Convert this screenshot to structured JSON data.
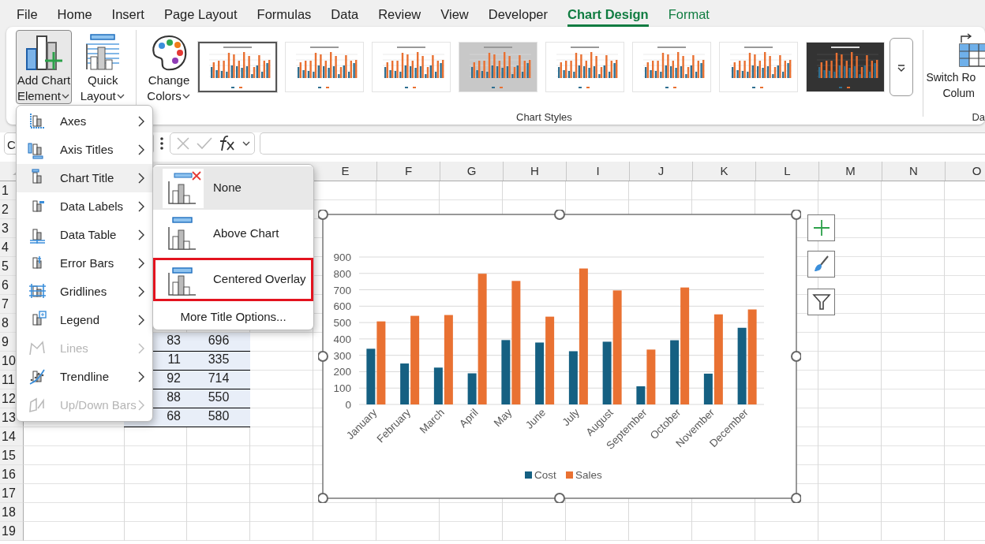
{
  "ribbon_tabs": [
    {
      "label": "File",
      "kind": "standard",
      "selected": false
    },
    {
      "label": "Home",
      "kind": "standard",
      "selected": false
    },
    {
      "label": "Insert",
      "kind": "standard",
      "selected": false
    },
    {
      "label": "Page Layout",
      "kind": "standard",
      "selected": false
    },
    {
      "label": "Formulas",
      "kind": "standard",
      "selected": false
    },
    {
      "label": "Data",
      "kind": "standard",
      "selected": false
    },
    {
      "label": "Review",
      "kind": "standard",
      "selected": false
    },
    {
      "label": "View",
      "kind": "standard",
      "selected": false
    },
    {
      "label": "Developer",
      "kind": "standard",
      "selected": false
    },
    {
      "label": "Chart Design",
      "kind": "contextual",
      "selected": true
    },
    {
      "label": "Format",
      "kind": "contextual",
      "selected": false
    }
  ],
  "ribbon": {
    "buttons": [
      {
        "kind": "add-element",
        "lines": [
          "Add Chart",
          "Element"
        ],
        "selected": true
      },
      {
        "kind": "quick-layout",
        "lines": [
          "Quick",
          "Layout"
        ],
        "selected": false
      },
      {
        "kind": "change-colors",
        "lines": [
          "Change",
          "Colors"
        ],
        "selected": false
      }
    ],
    "chart_styles": {
      "label": "Chart Styles",
      "items": [
        {
          "selected": true,
          "color": "#ffffff"
        },
        {
          "selected": false,
          "color": "#ffffff"
        },
        {
          "selected": false,
          "color": "#ffffff"
        },
        {
          "selected": false,
          "color": "#c8c8c8"
        },
        {
          "selected": false,
          "color": "#ffffff"
        },
        {
          "selected": false,
          "color": "#ffffff"
        },
        {
          "selected": false,
          "color": "#ffffff"
        },
        {
          "selected": false,
          "color": "#333333"
        }
      ]
    },
    "switch_button": {
      "lines": [
        "Switch Ro",
        "Colum"
      ]
    },
    "next_group_label": "Da"
  },
  "formula_bar": {
    "name_box": "C"
  },
  "sheet": {
    "column_headers": [
      "E",
      "F",
      "G",
      "H",
      "I",
      "J",
      "K",
      "L",
      "M",
      "N",
      "O"
    ],
    "rows": [
      {
        "number": "1"
      },
      {
        "number": "2"
      },
      {
        "number": "3"
      },
      {
        "number": "4"
      },
      {
        "number": "5"
      },
      {
        "number": "6"
      },
      {
        "number": "7"
      },
      {
        "number": "8"
      },
      {
        "number": "9",
        "cells": [
          "83",
          "696"
        ]
      },
      {
        "number": "10",
        "cells": [
          "11",
          "335"
        ]
      },
      {
        "number": "11",
        "cells": [
          "92",
          "714"
        ]
      },
      {
        "number": "12",
        "cells": [
          "88",
          "550"
        ]
      },
      {
        "number": "13",
        "cells": [
          "68",
          "580"
        ]
      },
      {
        "number": "14"
      },
      {
        "number": "15"
      },
      {
        "number": "16"
      },
      {
        "number": "17"
      },
      {
        "number": "18"
      },
      {
        "number": "19"
      }
    ]
  },
  "chart": {
    "chart_data": {
      "type": "bar",
      "categories": [
        "January",
        "February",
        "March",
        "April",
        "May",
        "June",
        "July",
        "August",
        "September",
        "October",
        "November",
        "December"
      ],
      "series": [
        {
          "name": "Cost",
          "color": "#156082",
          "values": [
            340,
            250,
            225,
            190,
            393,
            378,
            325,
            383,
            111,
            392,
            188,
            468
          ]
        },
        {
          "name": "Sales",
          "color": "#e97132",
          "values": [
            507,
            541,
            546,
            798,
            754,
            536,
            830,
            696,
            335,
            714,
            550,
            580
          ]
        }
      ],
      "grid": true,
      "legend": "bottom",
      "ylim": [
        0,
        900
      ],
      "yticks": [
        0,
        100,
        200,
        300,
        400,
        500,
        600,
        700,
        800,
        900
      ]
    }
  },
  "add_element_menu": {
    "items": [
      {
        "label": "Axes",
        "kind": "axes",
        "disabled": false,
        "selected": false
      },
      {
        "label": "Axis Titles",
        "kind": "axis-titles",
        "disabled": false,
        "selected": false
      },
      {
        "label": "Chart Title",
        "kind": "chart-title",
        "disabled": false,
        "selected": true
      },
      {
        "label": "Data Labels",
        "kind": "data-labels",
        "disabled": false,
        "selected": false
      },
      {
        "label": "Data Table",
        "kind": "data-table",
        "disabled": false,
        "selected": false
      },
      {
        "label": "Error Bars",
        "kind": "error-bars",
        "disabled": false,
        "selected": false
      },
      {
        "label": "Gridlines",
        "kind": "gridlines",
        "disabled": false,
        "selected": false
      },
      {
        "label": "Legend",
        "kind": "legend",
        "disabled": false,
        "selected": false
      },
      {
        "label": "Lines",
        "kind": "lines",
        "disabled": true,
        "selected": false
      },
      {
        "label": "Trendline",
        "kind": "trendline",
        "disabled": false,
        "selected": false
      },
      {
        "label": "Up/Down Bars",
        "kind": "updown",
        "disabled": true,
        "selected": false
      }
    ]
  },
  "chart_title_submenu": {
    "items": [
      {
        "label": "None",
        "kind": "none",
        "selected": true,
        "highlighted": false
      },
      {
        "label": "Above Chart",
        "kind": "above",
        "selected": false,
        "highlighted": false
      },
      {
        "label": "Centered Overlay",
        "kind": "overlay",
        "selected": false,
        "highlighted": true
      }
    ],
    "more": {
      "label": "More Title Options..."
    }
  }
}
